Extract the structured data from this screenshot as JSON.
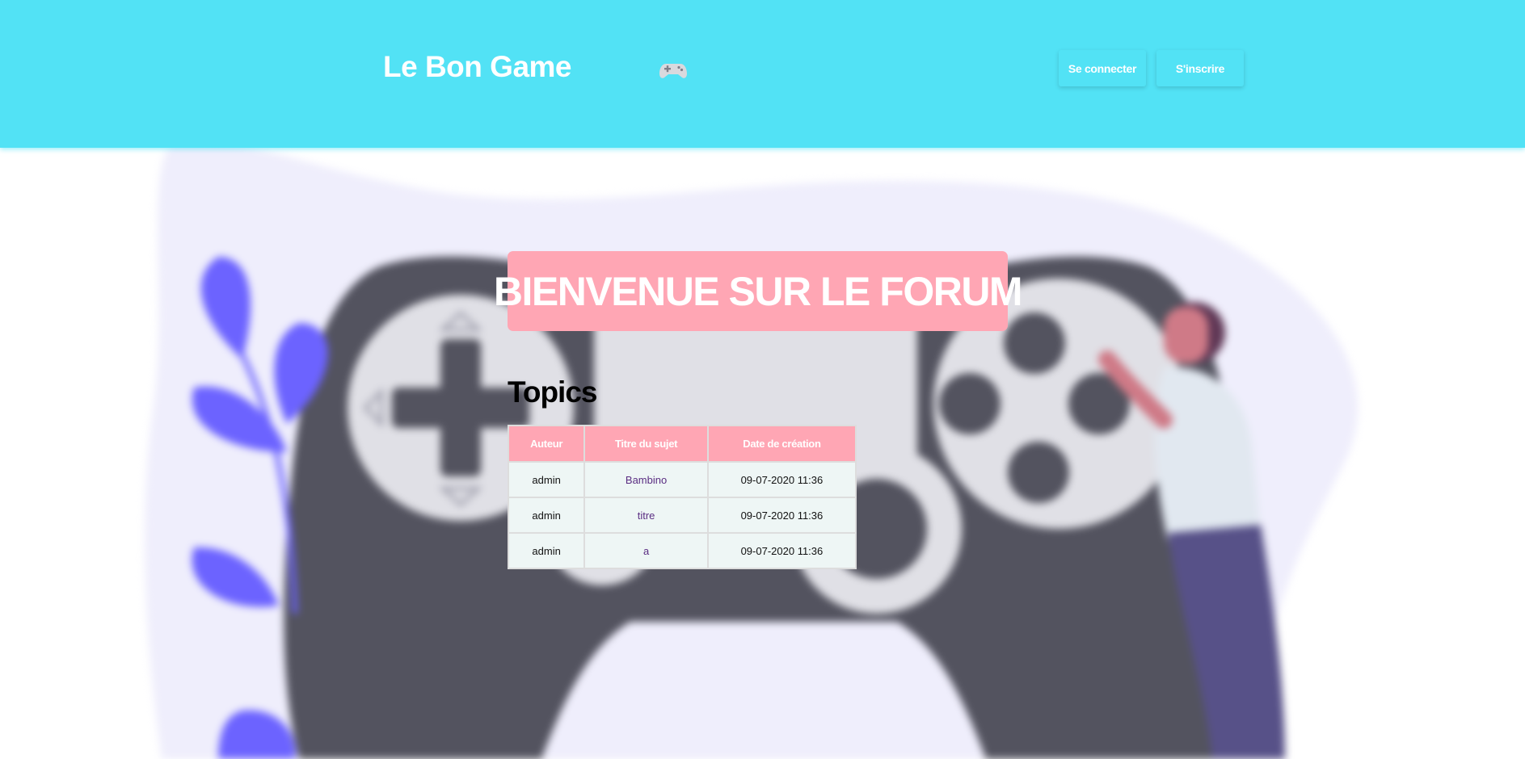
{
  "header": {
    "site_title": "Le Bon Game",
    "login_label": "Se connecter",
    "signup_label": "S'inscrire"
  },
  "main": {
    "welcome_banner": "BIENVENUE SUR LE FORUM",
    "topics_heading": "Topics",
    "table": {
      "columns": [
        "Auteur",
        "Titre du sujet",
        "Date de création"
      ],
      "rows": [
        {
          "author": "admin",
          "title": "Bambino",
          "date": "09-07-2020 11:36"
        },
        {
          "author": "admin",
          "title": "titre",
          "date": "09-07-2020 11:36"
        },
        {
          "author": "admin",
          "title": "a",
          "date": "09-07-2020 11:36"
        }
      ]
    }
  },
  "icons": {
    "header_icon": "gamepad-icon",
    "background": "gamepad-illustration"
  },
  "colors": {
    "header_bg": "#52e2f5",
    "accent_pink": "#ffa6b4",
    "blob_bg": "#efeefc",
    "controller_dark": "#53535f",
    "leaf_purple": "#6c63ff",
    "table_cell_bg": "#eef6f5",
    "link_purple": "#5a2d82"
  }
}
